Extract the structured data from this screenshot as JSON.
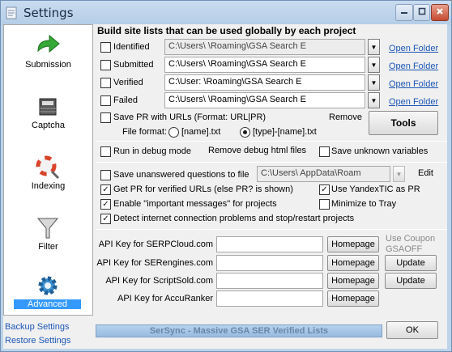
{
  "window": {
    "title": "Settings"
  },
  "sidebar": {
    "items": [
      {
        "label": "Submission"
      },
      {
        "label": "Captcha"
      },
      {
        "label": "Indexing"
      },
      {
        "label": "Filter"
      },
      {
        "label": "Advanced"
      }
    ],
    "links": {
      "backup": "Backup Settings",
      "restore": "Restore Settings"
    }
  },
  "global_lists": {
    "heading": "Build site lists that can be used globally by each project",
    "rows": [
      {
        "label": "Identified",
        "path": "C:\\Users\\          \\Roaming\\GSA Search E",
        "open": "Open Folder"
      },
      {
        "label": "Submitted",
        "path": "C:\\Users\\          \\Roaming\\GSA Search E",
        "open": "Open Folder"
      },
      {
        "label": "Verified",
        "path": "C:\\User:              \\Roaming\\GSA Search E",
        "open": "Open Folder"
      },
      {
        "label": "Failed",
        "path": "C:\\Users\\          \\Roaming\\GSA Search E",
        "open": "Open Folder"
      }
    ],
    "save_pr": "Save PR with URLs (Format: URL|PR)",
    "remove": "Remove",
    "tools": "Tools",
    "file_format_label": "File format:",
    "format_name": "[name].txt",
    "format_type_name": "[type]-[name].txt"
  },
  "debug": {
    "run_debug": "Run in debug mode",
    "remove_debug": "Remove debug html files",
    "save_unknown": "Save unknown variables"
  },
  "options": {
    "save_unanswered": "Save unanswered questions to file",
    "unanswered_path": "C:\\Users\\          AppData\\Roam",
    "edit": "Edit",
    "get_pr": "Get PR for verified URLs (else PR? is shown)",
    "use_yandex": "Use YandexTIC as PR",
    "important_msgs": "Enable \"important messages\" for projects",
    "minimize_tray": "Minimize to Tray",
    "detect_internet": "Detect internet connection problems and stop/restart projects"
  },
  "api_keys": [
    {
      "label": "API Key for SERPCloud.com",
      "homepage": "Homepage"
    },
    {
      "label": "API Key for SERengines.com",
      "homepage": "Homepage",
      "update": "Update"
    },
    {
      "label": "API Key for ScriptSold.com",
      "homepage": "Homepage",
      "update": "Update"
    },
    {
      "label": "API Key for AccuRanker",
      "homepage": "Homepage"
    }
  ],
  "coupon": {
    "line1": "Use Coupon",
    "line2": "GSAOFF"
  },
  "footer": {
    "banner": "SerSync - Massive GSA SER Verified Lists",
    "ok": "OK"
  }
}
